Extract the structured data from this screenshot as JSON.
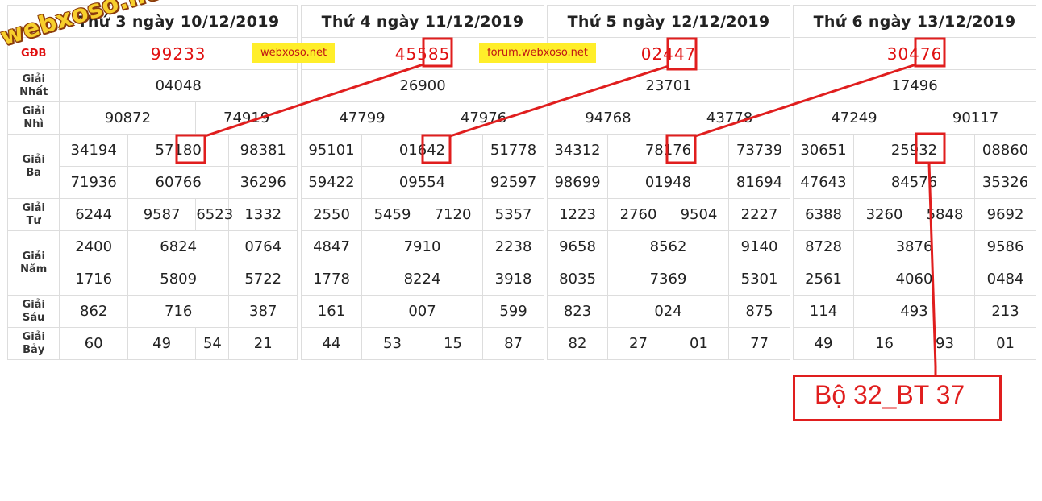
{
  "labels": {
    "gdb": "GĐB",
    "nhat": [
      "Giải",
      "Nhất"
    ],
    "nhi": [
      "Giải",
      "Nhì"
    ],
    "ba": [
      "Giải",
      "Ba"
    ],
    "tu": [
      "Giải",
      "Tư"
    ],
    "nam": [
      "Giải",
      "Năm"
    ],
    "sau": [
      "Giải",
      "Sáu"
    ],
    "bay": [
      "Giải",
      "Bảy"
    ]
  },
  "watermark": "webxoso.net",
  "badges": [
    "webxoso.net",
    "forum.webxoso.net"
  ],
  "days": [
    {
      "header": "Thứ 3 ngày 10/12/2019",
      "db": "99233",
      "nhat": "04048",
      "nhi": [
        "90872",
        "74919"
      ],
      "ba": [
        "34194",
        "57180",
        "98381",
        "71936",
        "60766",
        "36296"
      ],
      "tu": [
        "6244",
        "9587",
        "6523",
        "1332"
      ],
      "nam": [
        "2400",
        "6824",
        "0764",
        "1716",
        "5809",
        "5722"
      ],
      "sau": [
        "862",
        "716",
        "387"
      ],
      "bay": [
        "60",
        "49",
        "54",
        "21"
      ]
    },
    {
      "header": "Thứ 4 ngày 11/12/2019",
      "db": "45585",
      "nhat": "26900",
      "nhi": [
        "47799",
        "47976"
      ],
      "ba": [
        "95101",
        "01642",
        "51778",
        "59422",
        "09554",
        "92597"
      ],
      "tu": [
        "2550",
        "5459",
        "7120",
        "5357"
      ],
      "nam": [
        "4847",
        "7910",
        "2238",
        "1778",
        "8224",
        "3918"
      ],
      "sau": [
        "161",
        "007",
        "599"
      ],
      "bay": [
        "44",
        "53",
        "15",
        "87"
      ]
    },
    {
      "header": "Thứ 5 ngày 12/12/2019",
      "db": "02447",
      "nhat": "23701",
      "nhi": [
        "94768",
        "43778"
      ],
      "ba": [
        "34312",
        "78176",
        "73739",
        "98699",
        "01948",
        "81694"
      ],
      "tu": [
        "1223",
        "2760",
        "9504",
        "2227"
      ],
      "nam": [
        "9658",
        "8562",
        "9140",
        "8035",
        "7369",
        "5301"
      ],
      "sau": [
        "823",
        "024",
        "875"
      ],
      "bay": [
        "82",
        "27",
        "01",
        "77"
      ]
    },
    {
      "header": "Thứ 6 ngày 13/12/2019",
      "db": "30476",
      "nhat": "17496",
      "nhi": [
        "47249",
        "90117"
      ],
      "ba": [
        "30651",
        "25932",
        "08860",
        "47643",
        "84576",
        "35326"
      ],
      "tu": [
        "6388",
        "3260",
        "5848",
        "9692"
      ],
      "nam": [
        "8728",
        "3876",
        "9586",
        "2561",
        "4060",
        "0484"
      ],
      "sau": [
        "114",
        "493",
        "213"
      ],
      "bay": [
        "49",
        "16",
        "93",
        "01"
      ]
    }
  ],
  "annotation": {
    "text": "Bộ 32_BT 37",
    "color": "#e01e1e"
  },
  "colors": {
    "special_prize": "#e01010",
    "badge_bg": "#ffee2a",
    "highlight": "#e01e1e"
  }
}
